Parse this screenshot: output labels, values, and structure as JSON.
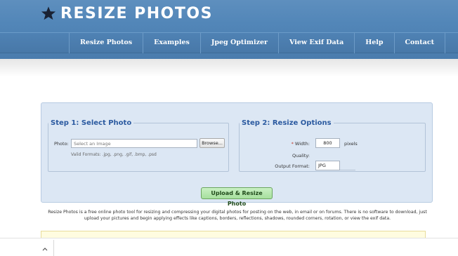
{
  "header": {
    "brand": "RESIZE PHOTOS",
    "logo_icon": "star-icon"
  },
  "nav": [
    {
      "label": "Resize Photos"
    },
    {
      "label": "Examples"
    },
    {
      "label": "Jpeg Optimizer"
    },
    {
      "label": "View Exif Data"
    },
    {
      "label": "Help"
    },
    {
      "label": "Contact"
    }
  ],
  "step1": {
    "title": "Step 1: Select Photo",
    "photo_label": "Photo:",
    "photo_placeholder": "Select an Image",
    "browse_label": "Browse...",
    "formats_text": "Valid Formats: .jpg, .png, .gif, .bmp, .psd"
  },
  "step2": {
    "title": "Step 2: Resize Options",
    "required_mark": "*",
    "width_label": "Width:",
    "width_value": "800",
    "pixels_label": "pixels",
    "quality_label": "Quality:",
    "format_label": "Output Format:",
    "format_value": "JPG"
  },
  "upload_button": "Upload & Resize Photo",
  "description": "Resize Photos is a free online photo tool for resizing and compressing your digital photos for posting on the web, in email or on forums. There is no software to download, just upload your pictures and begin applying effects like captions, borders, reflections, shadows, rounded corners, rotation, or view the exif data.",
  "colors": {
    "header": "#5286b8",
    "panel": "#dce7f4",
    "legend": "#2b5aa0",
    "upload_button": "#a6df9d"
  }
}
